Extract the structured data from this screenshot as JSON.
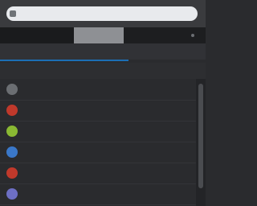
{
  "browser": {
    "url": "",
    "favicon_icon": "favicon-icon"
  },
  "app": {
    "title": "",
    "header_right": ""
  },
  "section": {
    "label": "",
    "meta": ""
  },
  "columns": {
    "from": "",
    "subject": ""
  },
  "rows": [
    {
      "name": "",
      "subject": "",
      "snippet": "",
      "time": "",
      "avatar_color": "#6b6e72"
    },
    {
      "name": "",
      "subject": "",
      "snippet": "",
      "time": "",
      "avatar_color": "#c0392b"
    },
    {
      "name": "",
      "subject": "",
      "snippet": "",
      "time": "",
      "avatar_color": "#8ab933"
    },
    {
      "name": "",
      "subject": "",
      "snippet": "",
      "time": "",
      "avatar_color": "#3a78c9"
    },
    {
      "name": "",
      "subject": "",
      "snippet": "",
      "time": "",
      "avatar_color": "#c0392b"
    },
    {
      "name": "",
      "subject": "",
      "snippet": "",
      "time": "",
      "avatar_color": "#6d6fc4"
    }
  ],
  "colors": {
    "accent": "#1c6fb5",
    "background": "#2a2b2e"
  }
}
